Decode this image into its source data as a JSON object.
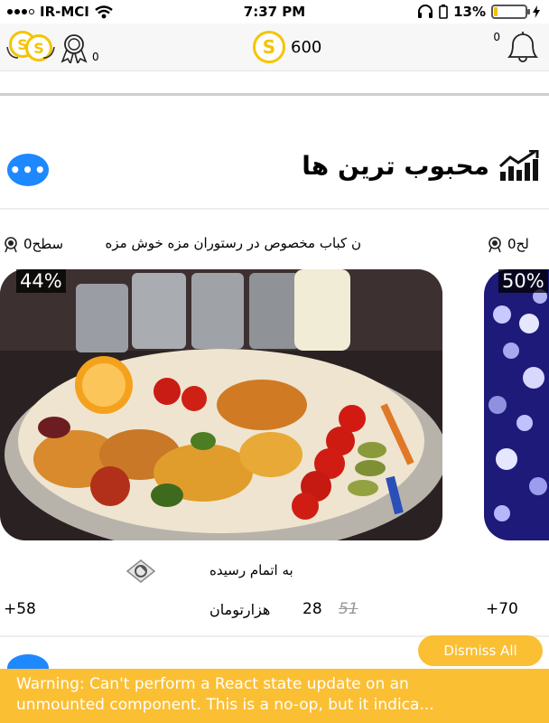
{
  "status_bar": {
    "carrier": "IR-MCI",
    "time": "7:37 PM",
    "battery_percent": "13%",
    "battery_level": 0.13
  },
  "header": {
    "coin_symbol": "S",
    "balance": "600",
    "badge_count": "0",
    "notification_count": "0"
  },
  "section": {
    "title": "محبوب ترین ها",
    "more_label": "•••"
  },
  "cards": [
    {
      "name": "ن کباب مخصوص در رستوران مزه خوش مزه",
      "level_label": "سطح0",
      "discount": "44%",
      "status": "به اتمام رسیده",
      "old_price": "51",
      "new_price": "28",
      "currency": "هزارتومان",
      "plus_count": "+58"
    },
    {
      "level_label": "لح0",
      "discount": "50%",
      "plus_count": "+70"
    }
  ],
  "yellowbox": {
    "dismiss_label": "Dismiss All",
    "warning_line1": "Warning: Can't perform a React state update on an",
    "warning_line2": "unmounted component. This is a no-op, but it indica..."
  },
  "colors": {
    "accent_blue": "#1e88ff",
    "coin_yellow": "#f5c400",
    "warning_yellow": "#fbbf34"
  }
}
